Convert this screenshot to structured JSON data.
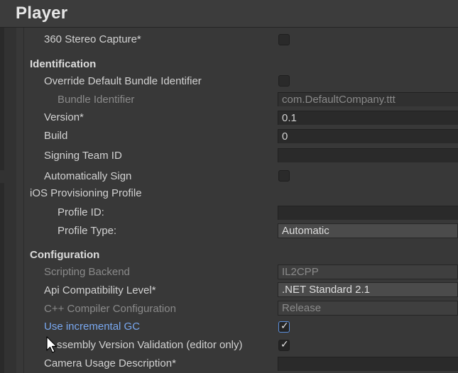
{
  "header": {
    "title": "Player"
  },
  "rows": {
    "stereo_capture": {
      "label": "360 Stereo Capture*",
      "checked": false
    },
    "identification": {
      "label": "Identification"
    },
    "override_bundle": {
      "label": "Override Default Bundle Identifier",
      "checked": false
    },
    "bundle_identifier": {
      "label": "Bundle Identifier",
      "value": "com.DefaultCompany.ttt"
    },
    "version": {
      "label": "Version*",
      "value": "0.1"
    },
    "build": {
      "label": "Build",
      "value": "0"
    },
    "signing_team": {
      "label": "Signing Team ID",
      "value": ""
    },
    "auto_sign": {
      "label": "Automatically Sign",
      "checked": false
    },
    "provisioning": {
      "label": "iOS Provisioning Profile"
    },
    "profile_id": {
      "label": "Profile ID:",
      "value": ""
    },
    "profile_type": {
      "label": "Profile Type:",
      "value": "Automatic"
    },
    "configuration": {
      "label": "Configuration"
    },
    "scripting_backend": {
      "label": "Scripting Backend",
      "value": "IL2CPP"
    },
    "api_level": {
      "label": "Api Compatibility Level*",
      "value": ".NET Standard 2.1"
    },
    "cpp_config": {
      "label": "C++ Compiler Configuration",
      "value": "Release"
    },
    "incremental_gc": {
      "label": "Use incremental GC",
      "checked": true
    },
    "assembly_validation": {
      "label": "ssembly Version Validation (editor only)",
      "checked": true
    },
    "camera_usage": {
      "label": "Camera Usage Description*",
      "value": ""
    }
  },
  "colors": {
    "background": "#383838",
    "link": "#79a8f0",
    "field": "#2a2a2a",
    "dropdown": "#4b4b4b"
  }
}
